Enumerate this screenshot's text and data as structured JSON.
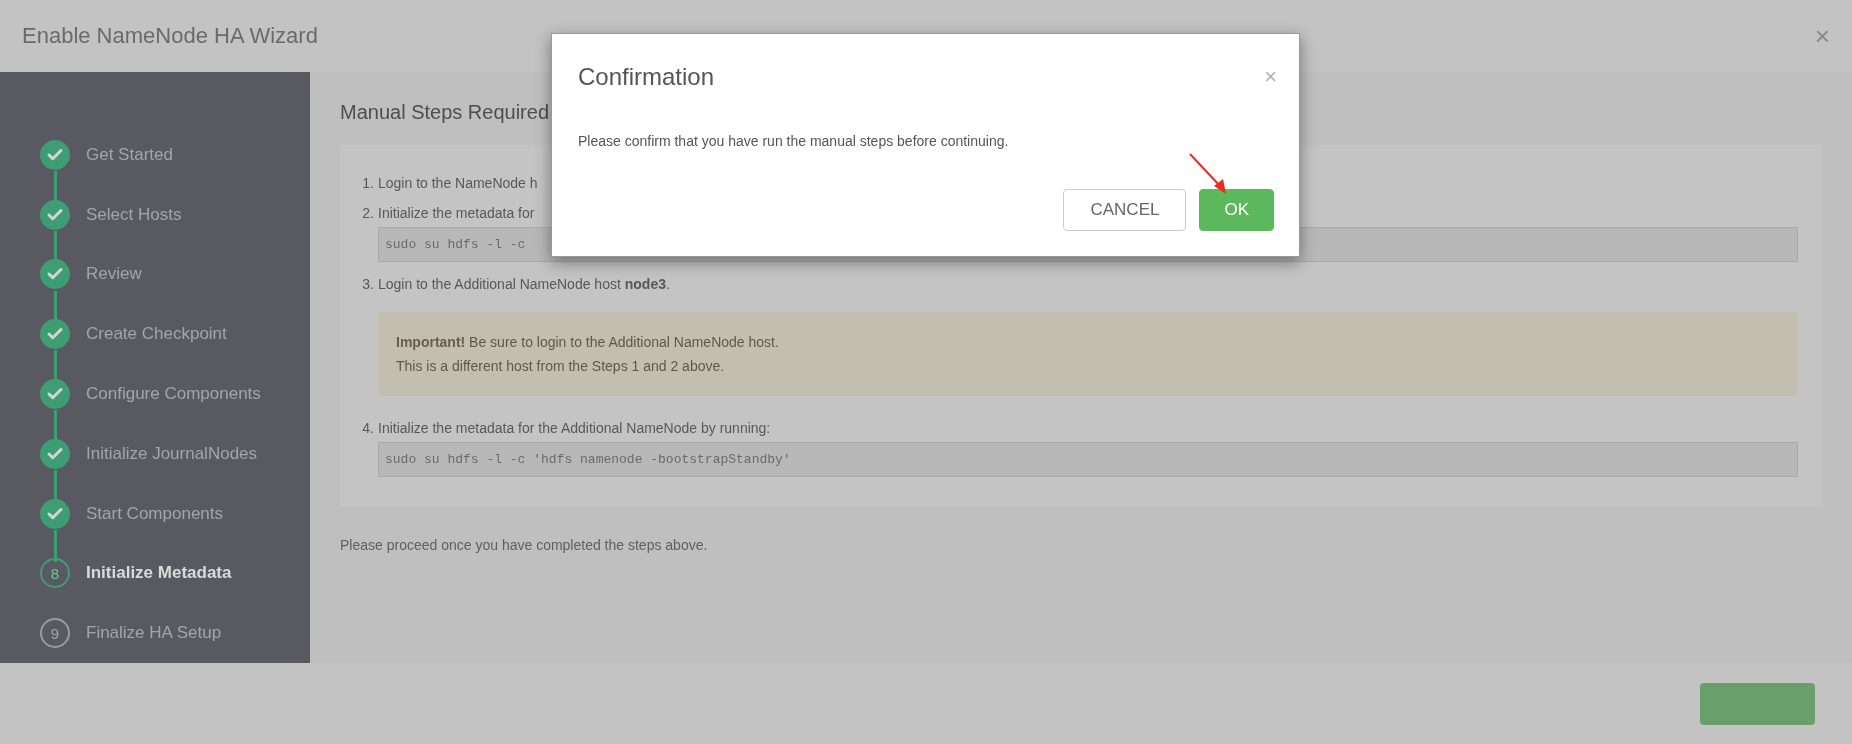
{
  "window": {
    "title": "Enable NameNode HA Wizard",
    "close": "×"
  },
  "sidebar": {
    "steps": [
      {
        "label": "Get Started",
        "kind": "done"
      },
      {
        "label": "Select Hosts",
        "kind": "done"
      },
      {
        "label": "Review",
        "kind": "done"
      },
      {
        "label": "Create Checkpoint",
        "kind": "done"
      },
      {
        "label": "Configure Components",
        "kind": "done"
      },
      {
        "label": "Initialize JournalNodes",
        "kind": "done"
      },
      {
        "label": "Start Components",
        "kind": "done"
      },
      {
        "label": "Initialize Metadata",
        "kind": "current",
        "number": "8"
      },
      {
        "label": "Finalize HA Setup",
        "kind": "pending",
        "number": "9"
      }
    ]
  },
  "main": {
    "heading": "Manual Steps Required",
    "steps": [
      {
        "kind": "text",
        "number": "1.",
        "text": "Login to the NameNode h"
      },
      {
        "kind": "code",
        "number": "2.",
        "text": "Initialize the metadata for",
        "code": "sudo su hdfs -l -c"
      },
      {
        "kind": "alert",
        "number": "3.",
        "text": "Login to the Additional NameNode host **node3**.",
        "alert": [
          "**Important!** Be sure to login to the Additional NameNode host.",
          "This is a different host from the Steps 1 and 2 above."
        ]
      },
      {
        "kind": "code",
        "number": "4.",
        "text": "Initialize the metadata for the Additional NameNode by running:",
        "code": "sudo su hdfs -l -c 'hdfs namenode -bootstrapStandby'"
      }
    ],
    "footnote": "Please proceed once you have completed the steps above."
  },
  "dialog": {
    "title": "Confirmation",
    "close": "×",
    "message": "Please confirm that you have run the manual steps before continuing.",
    "buttons": [
      {
        "label": "CANCEL",
        "kind": "secondary"
      },
      {
        "label": "OK",
        "kind": "primary"
      }
    ]
  }
}
